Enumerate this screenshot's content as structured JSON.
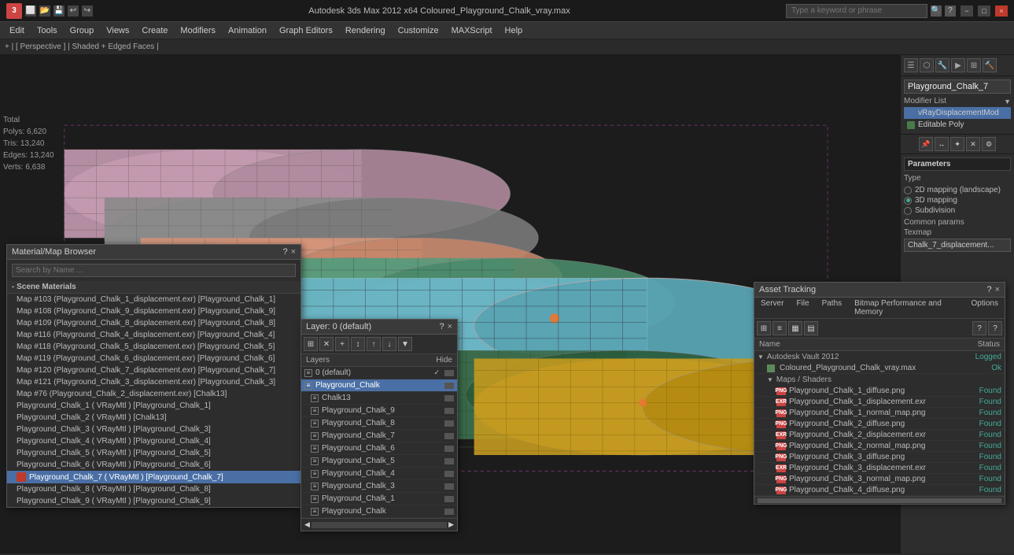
{
  "titlebar": {
    "app_icon": "3ds-max-icon",
    "title": "Autodesk 3ds Max 2012 x64     Coloured_Playground_Chalk_vray.max",
    "search_placeholder": "Type a keyword or phrase",
    "minimize_label": "−",
    "maximize_label": "□",
    "close_label": "×"
  },
  "menubar": {
    "items": [
      "Edit",
      "Tools",
      "Group",
      "Views",
      "Create",
      "Modifiers",
      "Animation",
      "Graph Editors",
      "Rendering",
      "Customize",
      "MAXScript",
      "Help"
    ]
  },
  "viewbar": {
    "labels": [
      "+ | [ Perspective ] | Shaded + Edged Faces |"
    ]
  },
  "stats": {
    "total_label": "Total",
    "polys_label": "Polys:",
    "polys_val": "6,620",
    "tris_label": "Tris:",
    "tris_val": "13,240",
    "edges_label": "Edges:",
    "edges_val": "13,240",
    "verts_label": "Verts:",
    "verts_val": "6,638"
  },
  "right_panel": {
    "obj_name": "Playground_Chalk_7",
    "modifier_list_label": "Modifier List",
    "modifiers": [
      {
        "name": "vRayDisplacementMod",
        "type": "blue",
        "selected": true
      },
      {
        "name": "Editable Poly",
        "type": "gray",
        "selected": false
      }
    ],
    "tools": [
      "↔",
      "↕",
      "⟳",
      "⊞",
      "◱",
      "◳",
      "⬡",
      "⊟"
    ],
    "params_title": "Parameters",
    "type_label": "Type",
    "mapping_options": [
      {
        "label": "2D mapping (landscape)",
        "selected": false
      },
      {
        "label": "3D mapping",
        "selected": true
      },
      {
        "label": "Subdivision",
        "selected": false
      }
    ],
    "common_params_label": "Common params",
    "texmap_label": "Texmap",
    "texmap_val": "Chalk_7_displacement..."
  },
  "material_browser": {
    "title": "Material/Map Browser",
    "search_placeholder": "Search by Name ...",
    "section_title": "- Scene Materials",
    "items": [
      {
        "text": "Map #103 (Playground_Chalk_1_displacement.exr) [Playground_Chalk_1]",
        "has_swatch": false
      },
      {
        "text": "Map #108 (Playground_Chalk_9_displacement.exr) [Playground_Chalk_9]",
        "has_swatch": false
      },
      {
        "text": "Map #109 (Playground_Chalk_8_displacement.exr) [Playground_Chalk_8]",
        "has_swatch": false
      },
      {
        "text": "Map #116 (Playground_Chalk_4_displacement.exr) [Playground_Chalk_4]",
        "has_swatch": false
      },
      {
        "text": "Map #118 (Playground_Chalk_5_displacement.exr) [Playground_Chalk_5]",
        "has_swatch": false
      },
      {
        "text": "Map #119 (Playground_Chalk_6_displacement.exr) [Playground_Chalk_6]",
        "has_swatch": false
      },
      {
        "text": "Map #120 (Playground_Chalk_7_displacement.exr) [Playground_Chalk_7]",
        "has_swatch": false
      },
      {
        "text": "Map #121 (Playground_Chalk_3_displacement.exr) [Playground_Chalk_3]",
        "has_swatch": false
      },
      {
        "text": "Map #76 (Playground_Chalk_2_displacement.exr) [Chalk13]",
        "has_swatch": false
      },
      {
        "text": "Playground_Chalk_1 ( VRayMtl ) [Playground_Chalk_1]",
        "has_swatch": false
      },
      {
        "text": "Playground_Chalk_2 ( VRayMtl ) [Chalk13]",
        "has_swatch": false
      },
      {
        "text": "Playground_Chalk_3 ( VRayMtl ) [Playground_Chalk_3]",
        "has_swatch": false
      },
      {
        "text": "Playground_Chalk_4 ( VRayMtl ) [Playground_Chalk_4]",
        "has_swatch": false
      },
      {
        "text": "Playground_Chalk_5 ( VRayMtl ) [Playground_Chalk_5]",
        "has_swatch": false
      },
      {
        "text": "Playground_Chalk_6 ( VRayMtl ) [Playground_Chalk_6]",
        "has_swatch": false
      },
      {
        "text": "Playground_Chalk_7 ( VRayMtl ) [Playground_Chalk_7]",
        "has_swatch": true,
        "selected": true
      },
      {
        "text": "Playground_Chalk_8 ( VRayMtl ) [Playground_Chalk_8]",
        "has_swatch": false
      },
      {
        "text": "Playground_Chalk_9 ( VRayMtl ) [Playground_Chalk_9]",
        "has_swatch": false
      }
    ]
  },
  "layer_manager": {
    "title": "Layer: 0 (default)",
    "layers_header": "Layers",
    "hide_header": "Hide",
    "layers": [
      {
        "name": "0 (default)",
        "indent": 0,
        "selected": false,
        "visible": true
      },
      {
        "name": "Playground_Chalk",
        "indent": 0,
        "selected": true,
        "visible": true
      },
      {
        "name": "Chalk13",
        "indent": 1,
        "selected": false,
        "visible": true
      },
      {
        "name": "Playground_Chalk_9",
        "indent": 1,
        "selected": false,
        "visible": true
      },
      {
        "name": "Playground_Chalk_8",
        "indent": 1,
        "selected": false,
        "visible": true
      },
      {
        "name": "Playground_Chalk_7",
        "indent": 1,
        "selected": false,
        "visible": true
      },
      {
        "name": "Playground_Chalk_6",
        "indent": 1,
        "selected": false,
        "visible": true
      },
      {
        "name": "Playground_Chalk_5",
        "indent": 1,
        "selected": false,
        "visible": true
      },
      {
        "name": "Playground_Chalk_4",
        "indent": 1,
        "selected": false,
        "visible": true
      },
      {
        "name": "Playground_Chalk_3",
        "indent": 1,
        "selected": false,
        "visible": true
      },
      {
        "name": "Playground_Chalk_1",
        "indent": 1,
        "selected": false,
        "visible": true
      },
      {
        "name": "Playground_Chalk",
        "indent": 1,
        "selected": false,
        "visible": true
      }
    ]
  },
  "asset_tracking": {
    "title": "Asset Tracking",
    "menu_items": [
      "Server",
      "File",
      "Paths",
      "Bitmap Performance and Memory",
      "Options"
    ],
    "toolbar_icons": [
      "⊞",
      "≡",
      "▦",
      "▤"
    ],
    "help_icons": [
      "?",
      "?"
    ],
    "table_header_name": "Name",
    "table_header_status": "Status",
    "groups": [
      {
        "name": "Autodesk Vault 2012",
        "status": "Logged",
        "items": [
          {
            "name": "Coloured_Playground_Chalk_vray.max",
            "status": "Ok",
            "icon": "max"
          },
          {
            "name": "Maps / Shaders",
            "is_group": true,
            "items": [
              {
                "name": "Playground_Chalk_1_diffuse.png",
                "status": "Found",
                "icon": "png"
              },
              {
                "name": "Playground_Chalk_1_displacement.exr",
                "status": "Found",
                "icon": "exr"
              },
              {
                "name": "Playground_Chalk_1_normal_map.png",
                "status": "Found",
                "icon": "png"
              },
              {
                "name": "Playground_Chalk_2_diffuse.png",
                "status": "Found",
                "icon": "png"
              },
              {
                "name": "Playground_Chalk_2_displacement.exr",
                "status": "Found",
                "icon": "exr"
              },
              {
                "name": "Playground_Chalk_2_normal_map.png",
                "status": "Found",
                "icon": "png"
              },
              {
                "name": "Playground_Chalk_3_diffuse.png",
                "status": "Found",
                "icon": "png"
              },
              {
                "name": "Playground_Chalk_3_displacement.exr",
                "status": "Found",
                "icon": "exr"
              },
              {
                "name": "Playground_Chalk_3_normal_map.png",
                "status": "Found",
                "icon": "png"
              },
              {
                "name": "Playground_Chalk_4_diffuse.png",
                "status": "Found",
                "icon": "png"
              }
            ]
          }
        ]
      }
    ]
  }
}
